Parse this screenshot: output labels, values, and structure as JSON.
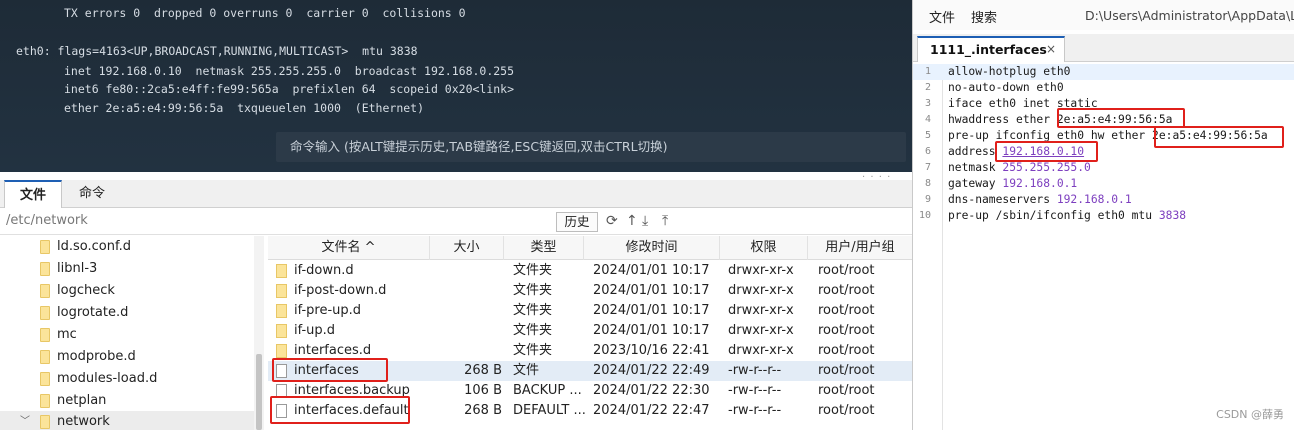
{
  "terminal": {
    "lines": [
      "TX errors 0  dropped 0 overruns 0  carrier 0  collisions 0",
      "eth0: flags=4163<UP,BROADCAST,RUNNING,MULTICAST>  mtu 3838",
      "inet 192.168.0.10  netmask 255.255.255.0  broadcast 192.168.0.255",
      "inet6 fe80::2ca5:e4ff:fe99:565a  prefixlen 64  scopeid 0x20<link>",
      "ether 2e:a5:e4:99:56:5a  txqueuelen 1000  (Ethernet)"
    ],
    "command_hint": "命令输入 (按ALT键提示历史,TAB键路径,ESC键返回,双击CTRL切换)"
  },
  "left_tabs": {
    "file": "文件",
    "command": "命令"
  },
  "path_bar": {
    "path": "/etc/network",
    "history_label": "历史"
  },
  "tree": {
    "items": [
      {
        "label": "ld.so.conf.d"
      },
      {
        "label": "libnl-3"
      },
      {
        "label": "logcheck"
      },
      {
        "label": "logrotate.d"
      },
      {
        "label": "mc"
      },
      {
        "label": "modprobe.d"
      },
      {
        "label": "modules-load.d"
      },
      {
        "label": "netplan"
      },
      {
        "label": "network"
      }
    ]
  },
  "file_list": {
    "headers": {
      "name": "文件名 ^",
      "size": "大小",
      "type": "类型",
      "mtime": "修改时间",
      "perm": "权限",
      "owner": "用户/用户组"
    },
    "rows": [
      {
        "name": "if-down.d",
        "size": "",
        "type": "文件夹",
        "mtime": "2024/01/01 10:17",
        "perm": "drwxr-xr-x",
        "owner": "root/root"
      },
      {
        "name": "if-post-down.d",
        "size": "",
        "type": "文件夹",
        "mtime": "2024/01/01 10:17",
        "perm": "drwxr-xr-x",
        "owner": "root/root"
      },
      {
        "name": "if-pre-up.d",
        "size": "",
        "type": "文件夹",
        "mtime": "2024/01/01 10:17",
        "perm": "drwxr-xr-x",
        "owner": "root/root"
      },
      {
        "name": "if-up.d",
        "size": "",
        "type": "文件夹",
        "mtime": "2024/01/01 10:17",
        "perm": "drwxr-xr-x",
        "owner": "root/root"
      },
      {
        "name": "interfaces.d",
        "size": "",
        "type": "文件夹",
        "mtime": "2023/10/16 22:41",
        "perm": "drwxr-xr-x",
        "owner": "root/root"
      },
      {
        "name": "interfaces",
        "size": "268 B",
        "type": "文件",
        "mtime": "2024/01/22 22:49",
        "perm": "-rw-r--r--",
        "owner": "root/root"
      },
      {
        "name": "interfaces.backup",
        "size": "106 B",
        "type": "BACKUP ...",
        "mtime": "2024/01/22 22:30",
        "perm": "-rw-r--r--",
        "owner": "root/root"
      },
      {
        "name": "interfaces.default",
        "size": "268 B",
        "type": "DEFAULT ...",
        "mtime": "2024/01/22 22:47",
        "perm": "-rw-r--r--",
        "owner": "root/root"
      }
    ]
  },
  "editor": {
    "menu": {
      "file": "文件",
      "search": "搜索"
    },
    "path": "D:\\Users\\Administrator\\AppData\\Lo",
    "tab_label": "1111_.interfaces",
    "close_glyph": "×",
    "lines": [
      {
        "n": "1",
        "a": "allow-hotplug eth0",
        "b": ""
      },
      {
        "n": "2",
        "a": "no-auto-down eth0",
        "b": ""
      },
      {
        "n": "3",
        "a": "iface eth0 inet static",
        "b": ""
      },
      {
        "n": "4",
        "a": "hwaddress ether ",
        "b": "2e:a5:e4:99:56:5a"
      },
      {
        "n": "5",
        "a": "pre-up ifconfig eth0 hw ether ",
        "b": "2e:a5:e4:99:56:5a"
      },
      {
        "n": "6",
        "a": "address ",
        "b": "192.168.0.10"
      },
      {
        "n": "7",
        "a": "netmask ",
        "b": "255.255.255.0"
      },
      {
        "n": "8",
        "a": "gateway ",
        "b": "192.168.0.1"
      },
      {
        "n": "9",
        "a": "dns-nameservers ",
        "b": "192.168.0.1"
      },
      {
        "n": "10",
        "a": "pre-up /sbin/ifconfig eth0 mtu ",
        "b": "3838"
      }
    ]
  },
  "watermark": "CSDN @薛勇",
  "colors": {
    "accent": "#1e5fb4",
    "highlight": "#e0201b",
    "number": "#7d3fbf"
  }
}
